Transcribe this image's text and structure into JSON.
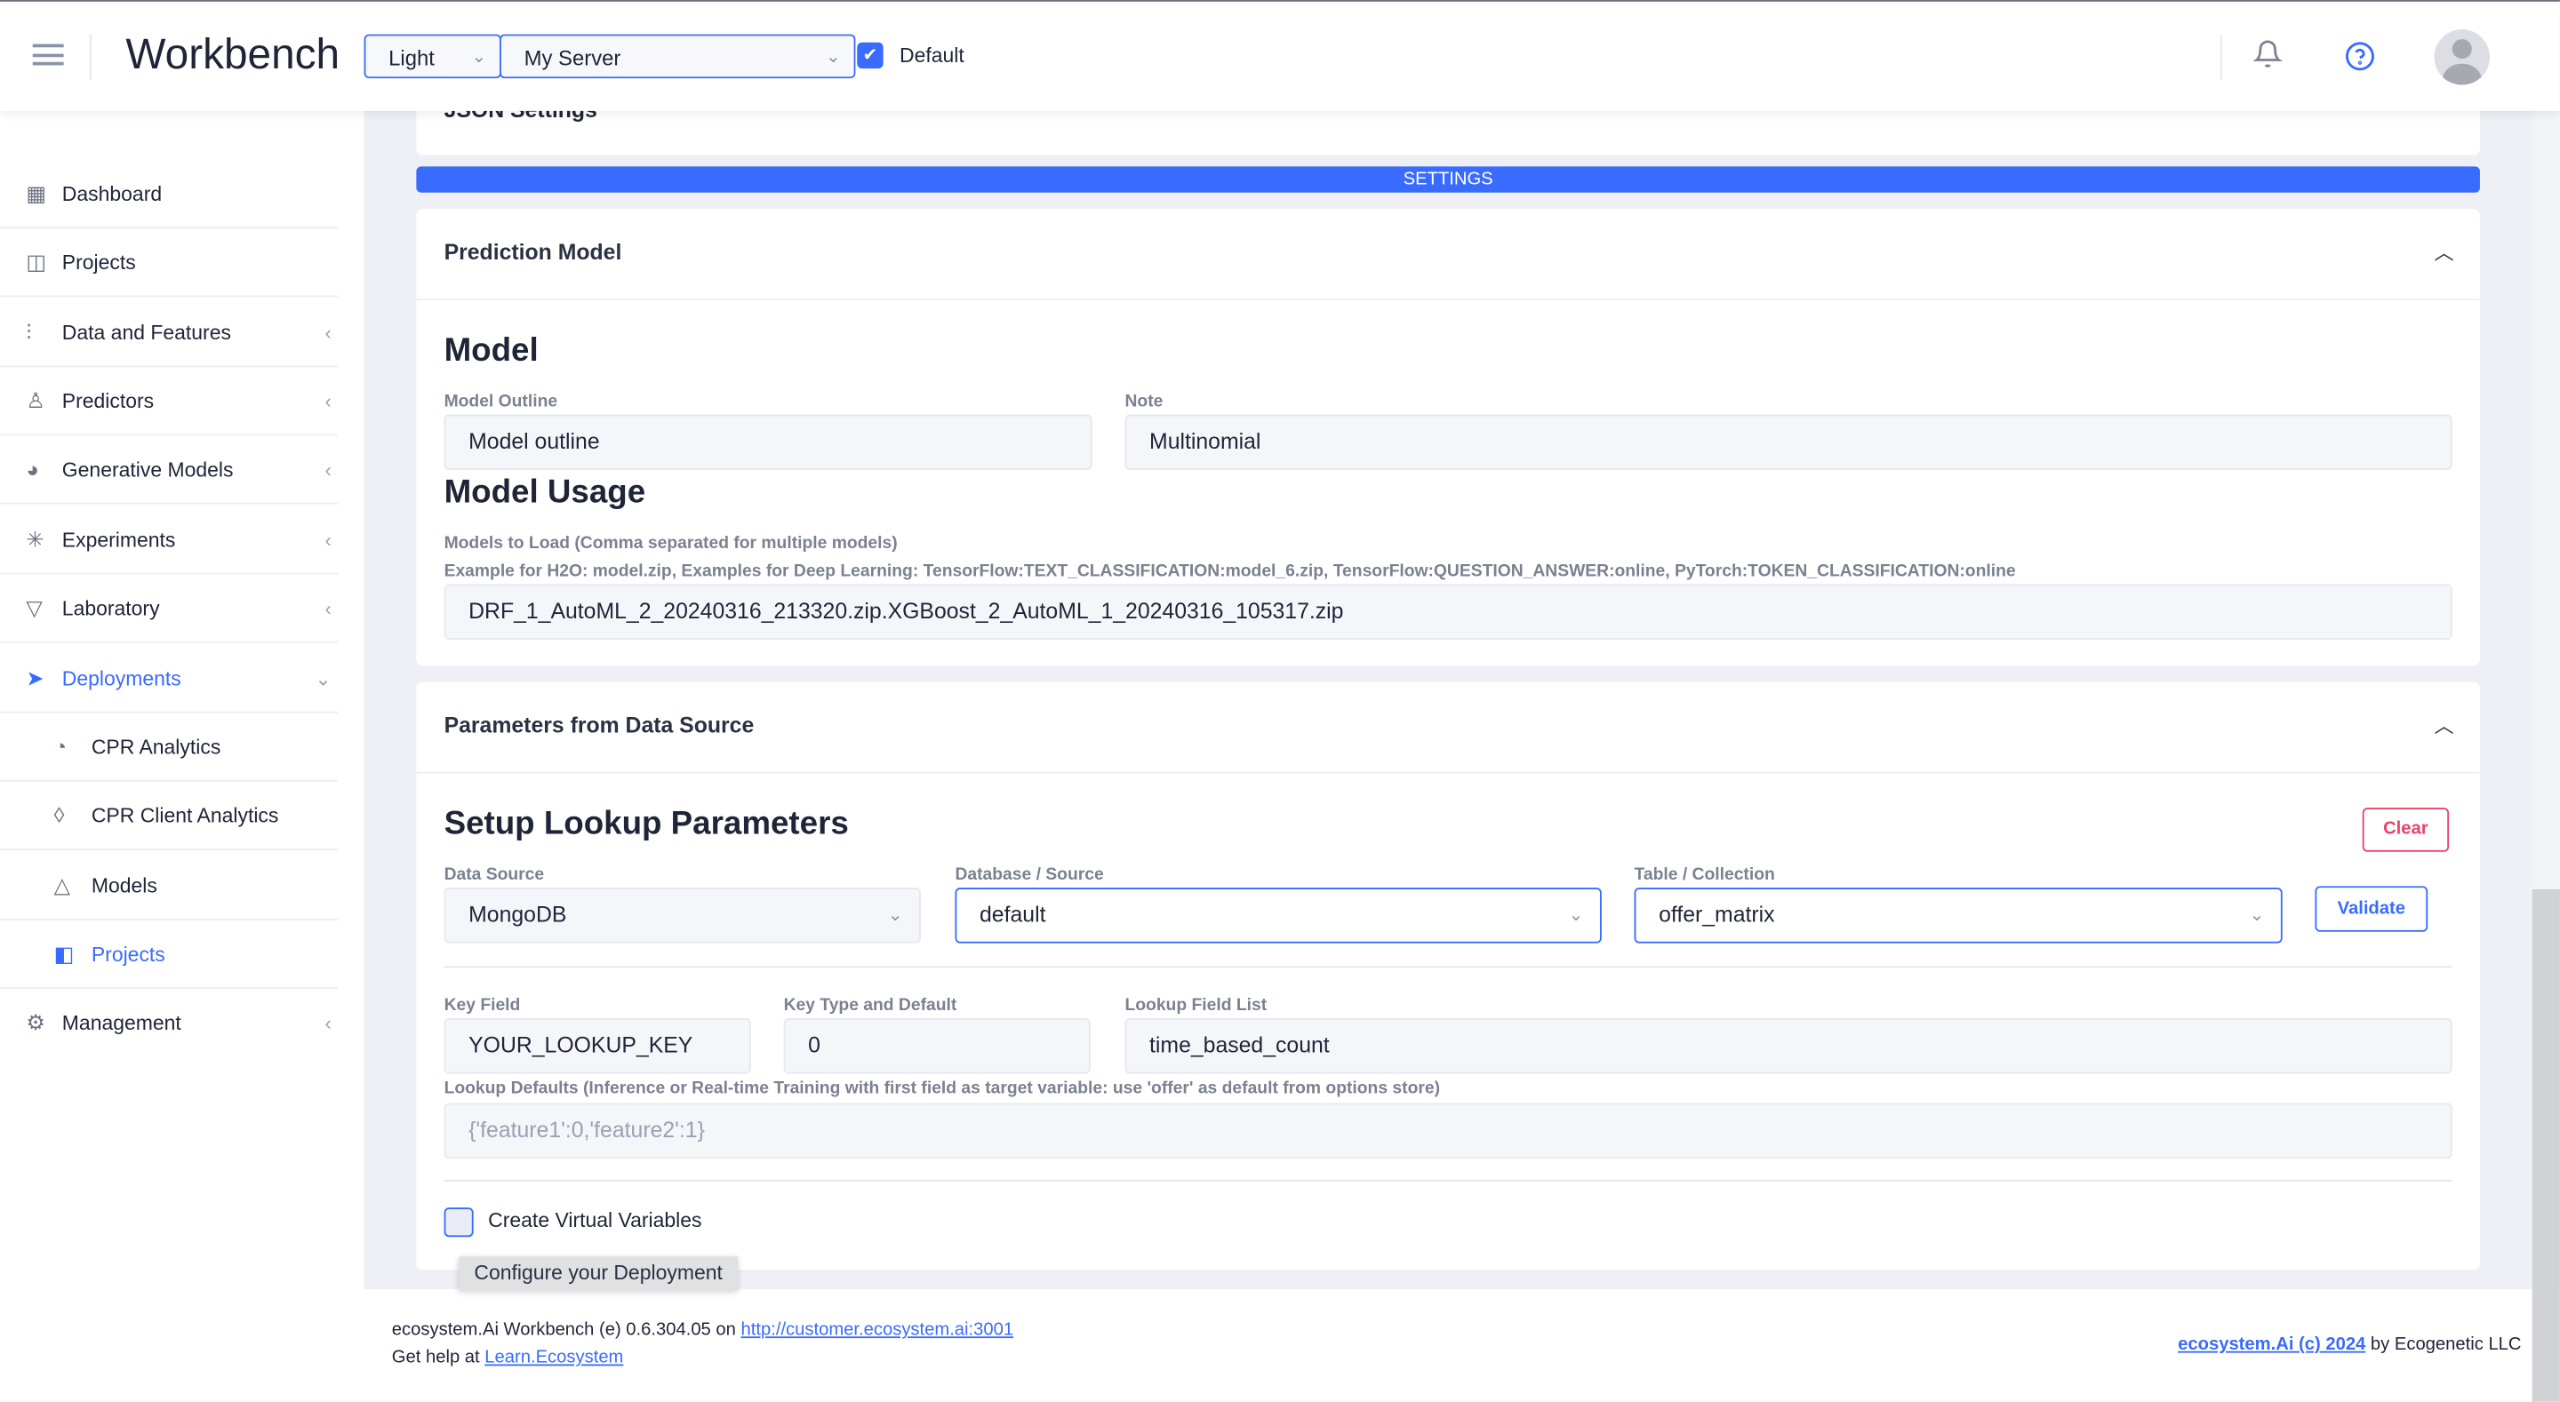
{
  "header": {
    "title": "Workbench",
    "theme": "Light",
    "server": "My Server",
    "default_checked": true,
    "default_label": "Default"
  },
  "sidebar": {
    "items": [
      {
        "label": "Dashboard",
        "icon": "dashboard-grid-icon"
      },
      {
        "label": "Projects",
        "icon": "projects-icon"
      },
      {
        "label": "Data and Features",
        "icon": "sliders-icon"
      },
      {
        "label": "Predictors",
        "icon": "award-icon"
      },
      {
        "label": "Generative Models",
        "icon": "palette-icon"
      },
      {
        "label": "Experiments",
        "icon": "loader-icon"
      },
      {
        "label": "Laboratory",
        "icon": "filter-icon"
      },
      {
        "label": "Deployments",
        "icon": "send-icon",
        "expanded": true
      },
      {
        "label": "CPR Analytics",
        "icon": "pie-chart-icon"
      },
      {
        "label": "CPR Client Analytics",
        "icon": "droplet-icon"
      },
      {
        "label": "Models",
        "icon": "triangle-icon"
      },
      {
        "label": "Projects",
        "icon": "layout-icon",
        "active": true
      },
      {
        "label": "Management",
        "icon": "gear-icon"
      }
    ]
  },
  "main": {
    "json_settings_title": "JSON Settings",
    "settings_bar": "SETTINGS",
    "prediction": {
      "title": "Prediction Model",
      "model_heading": "Model",
      "outline_label": "Model Outline",
      "outline_value": "Model outline",
      "note_label": "Note",
      "note_value": "Multinomial",
      "usage_heading": "Model Usage",
      "load_label": "Models to Load (Comma separated for multiple models)",
      "load_example": "Example for H2O: model.zip, Examples for Deep Learning: TensorFlow:TEXT_CLASSIFICATION:model_6.zip, TensorFlow:QUESTION_ANSWER:online, PyTorch:TOKEN_CLASSIFICATION:online",
      "load_value": "DRF_1_AutoML_2_20240316_213320.zip.XGBoost_2_AutoML_1_20240316_105317.zip"
    },
    "params": {
      "title": "Parameters from Data Source",
      "heading": "Setup Lookup Parameters",
      "clear": "Clear",
      "validate": "Validate",
      "ds_label": "Data Source",
      "ds_value": "MongoDB",
      "db_label": "Database / Source",
      "db_value": "default",
      "table_label": "Table / Collection",
      "table_value": "offer_matrix",
      "key_label": "Key Field",
      "key_value": "YOUR_LOOKUP_KEY",
      "keytype_label": "Key Type and Default",
      "keytype_value": "0",
      "lfl_label": "Lookup Field List",
      "lfl_value": "time_based_count",
      "defaults_label": "Lookup Defaults (Inference or Real-time Training with first field as target variable: use 'offer' as default from options store)",
      "defaults_placeholder": "{'feature1':0,'feature2':1}",
      "virtual_label": "Create Virtual Variables",
      "virtual_checked": false
    },
    "tooltip": "Configure your Deployment"
  },
  "footer": {
    "version_text": "ecosystem.Ai Workbench (e) 0.6.304.05 on",
    "url": "http://customer.ecosystem.ai:3001",
    "help_text": "Get help at",
    "help_link": "Learn.Ecosystem",
    "copyright_link": "ecosystem.Ai (c) 2024",
    "copyright_text": "by Ecogenetic LLC"
  },
  "colors": {
    "accent": "#3a6bff",
    "danger": "#e8436a"
  }
}
